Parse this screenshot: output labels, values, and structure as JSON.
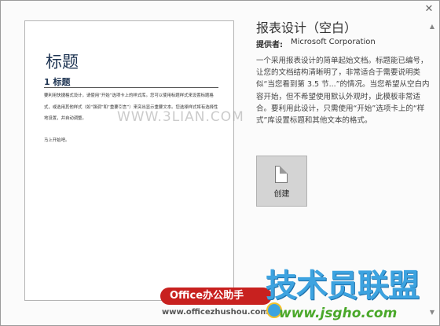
{
  "template": {
    "preview_title": "标题",
    "preview_heading": "1 标题",
    "preview_body": "要利用快捷格式设计，请使用“开始”选项卡上的样式库。您可以使用标题样式来设置标题格式，或选用其他样式（如“强调”和“重要引言”）来突出显示重要文本。您选择样式将有选择性地设置，并自动调整。",
    "preview_footer": "马上开始吧。",
    "watermark": "WWW.3LIAN.COM"
  },
  "panel": {
    "title": "报表设计（空白）",
    "provider_label": "提供者:",
    "provider_value": "Microsoft Corporation",
    "description": "一个采用报表设计的简单起始文档。标题能已编号，让您的文档结构清晰明了，非常适合于需要说明类似“当您看到第 3.5 节...”的情况。当您希望从空白内容开始，但不希望使用默认外观时，此模板非常适合。要利用此设计，只需使用“开始”选项卡上的“样式”库设置标题和其他文本的格式。",
    "create_label": "创建"
  },
  "window": {
    "close_glyph": "✕",
    "scroll_up_glyph": "▲",
    "scroll_down_glyph": "▼"
  },
  "logos": {
    "office_badge": "Office办公助手",
    "office_url": "www.officezhushou.com",
    "brand_cn": "技术员联盟",
    "brand_url": "www.jsgho.com"
  },
  "colors": {
    "heading_blue": "#1f3553",
    "office_red": "#c8211f",
    "brand_blue": "#3da3e0",
    "brand_green": "#4aa82a"
  }
}
